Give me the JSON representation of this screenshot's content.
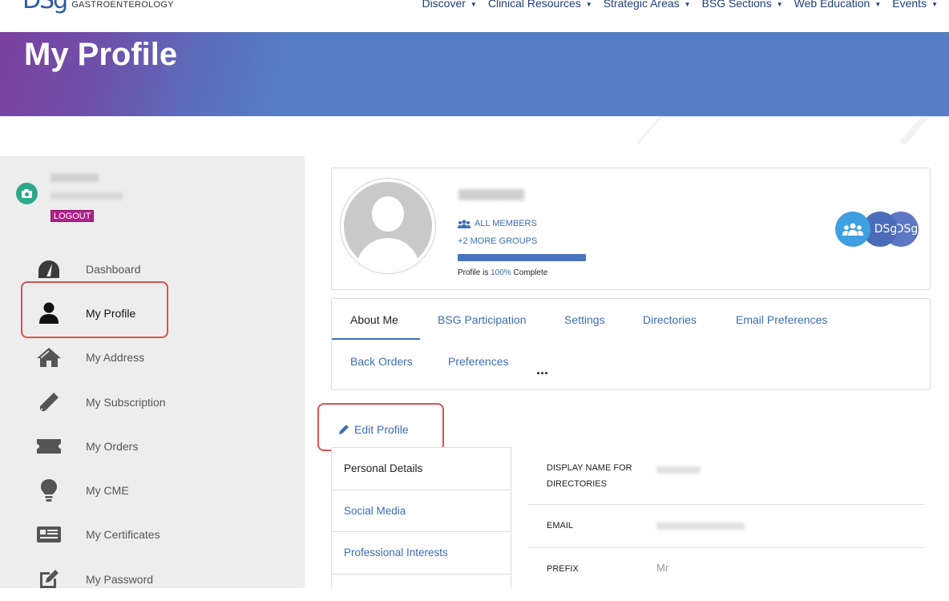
{
  "header": {
    "logo_mark": "DSg",
    "logo_text": "GASTROENTEROLOGY",
    "nav": [
      "Discover",
      "Clinical Resources",
      "Strategic Areas",
      "BSG Sections",
      "Web Education",
      "Events"
    ]
  },
  "banner": {
    "title": "My Profile",
    "gradient_start": "#7b3fa0",
    "gradient_end": "#557ec4"
  },
  "sidebar": {
    "logout_label": "LOGOUT",
    "items": [
      {
        "label": "Dashboard",
        "icon": "gauge-icon"
      },
      {
        "label": "My Profile",
        "icon": "user-icon",
        "active": true
      },
      {
        "label": "My Address",
        "icon": "home-icon"
      },
      {
        "label": "My Subscription",
        "icon": "pencil-icon"
      },
      {
        "label": "My Orders",
        "icon": "ticket-icon"
      },
      {
        "label": "My CME",
        "icon": "lightbulb-icon"
      },
      {
        "label": "My Certificates",
        "icon": "certificate-icon"
      },
      {
        "label": "My Password",
        "icon": "edit-square-icon"
      }
    ]
  },
  "profile": {
    "groups_label": "ALL MEMBERS",
    "more_groups": "+2 MORE GROUPS",
    "completion": 100,
    "completion_prefix": "Profile is ",
    "completion_value": "100%",
    "completion_suffix": " Complete",
    "badge_text": "DSg"
  },
  "tabs": {
    "items": [
      "About Me",
      "BSG Participation",
      "Settings",
      "Directories",
      "Email Preferences",
      "Back Orders",
      "Preferences"
    ],
    "more": "..."
  },
  "edit_label": "Edit Profile",
  "subnav": [
    "Personal Details",
    "Social Media",
    "Professional Interests"
  ],
  "details": [
    {
      "label": "DISPLAY NAME FOR DIRECTORIES",
      "value": ""
    },
    {
      "label": "EMAIL",
      "value": ""
    },
    {
      "label": "PREFIX",
      "value": "Mr"
    }
  ],
  "colors": {
    "accent": "#3e6db5",
    "logout": "#b01f8a",
    "highlight": "#d9534f",
    "camera": "#2ea88b"
  }
}
